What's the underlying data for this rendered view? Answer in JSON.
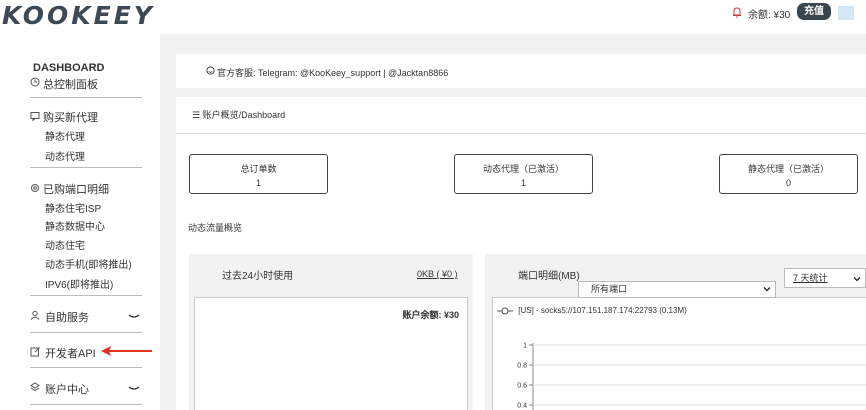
{
  "header": {
    "logo": "KOOKEEY",
    "balance_label": "余额: ¥30",
    "recharge_label": "充值"
  },
  "sidebar": {
    "dashboard_title": "DASHBOARD",
    "dashboard_label": "总控制面板",
    "buy_proxy_label": "购买新代理",
    "buy_items": [
      "静态代理",
      "动态代理"
    ],
    "ports_label": "已购端口明细",
    "port_items": [
      "静态住宅ISP",
      "静态数据中心",
      "动态住宅",
      "动态手机(即将推出)",
      "IPV6(即将推出)"
    ],
    "self_service_label": "自助服务",
    "developer_api_label": "开发者API",
    "account_center_label": "账户中心"
  },
  "support": {
    "text": "官方客服:  Telegram: @KooKeey_support | @Jacktan8866"
  },
  "breadcrumb": "账户概览/Dashboard",
  "stats": [
    {
      "label": "总订单数",
      "value": "1"
    },
    {
      "label": "动态代理（已激活）",
      "value": "1"
    },
    {
      "label": "静态代理（已激活）",
      "value": "0"
    }
  ],
  "flow": {
    "title": "动态流量概览",
    "usage_title": "过去24小时使用",
    "usage_link": "0KB ( ¥0 )",
    "account_balance": "账户余额: ¥30",
    "port_title": "端口明细(MB)",
    "port_select_value": "所有端口",
    "days_select_value": "7 天统计"
  },
  "chart_data": {
    "type": "line",
    "series": [
      {
        "name": "[US] - socks5://107.151.187.174:22793    (0.13M)",
        "values": []
      }
    ],
    "yticks": [
      "1",
      "0.8",
      "0.6",
      "0.4"
    ],
    "ylim": [
      0,
      1
    ]
  },
  "colors": {
    "dark_accent": "#3a4650",
    "arrow": "#e8321e",
    "content_bg": "#f2f2f3"
  }
}
